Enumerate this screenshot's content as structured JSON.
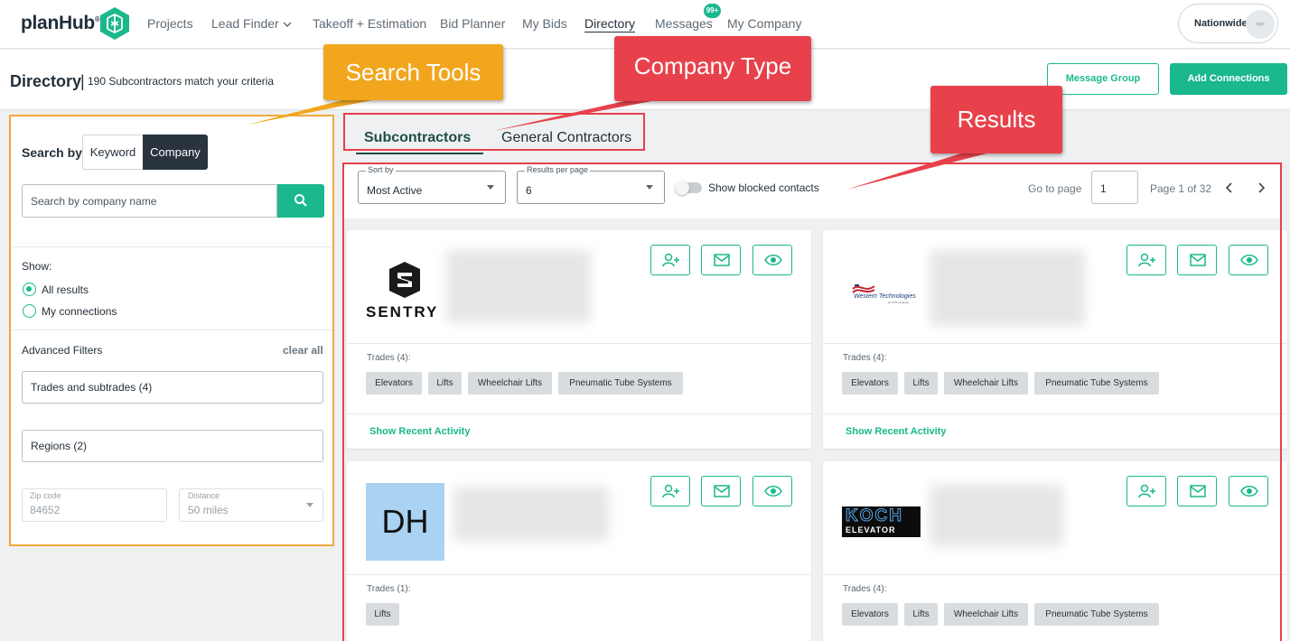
{
  "app": {
    "logo": "planHub",
    "logo_mark": "®"
  },
  "nav": {
    "items": [
      "Projects",
      "Lead Finder",
      "Takeoff + Estimation",
      "Bid Planner",
      "My Bids",
      "Directory",
      "Messages",
      "My Company"
    ],
    "messages_badge": "99+",
    "account": {
      "name": "Nationwide",
      "logo": "logo"
    }
  },
  "header": {
    "title": "Directory",
    "separator": "|",
    "subtitle": "190 Subcontractors match your criteria",
    "message_group": "Message Group",
    "add_connections": "Add Connections"
  },
  "sidebar": {
    "search_by": "Search by:",
    "keyword": "Keyword",
    "company": "Company",
    "search_placeholder": "Search by company name",
    "show": "Show:",
    "all_results": "All results",
    "my_connections": "My connections",
    "advanced_filters": "Advanced Filters",
    "clear_all": "clear all",
    "trades_filter": "Trades and subtrades (4)",
    "regions_filter": "Regions (2)",
    "zip_label": "Zip code",
    "zip_value": "84652",
    "distance_label": "Distance",
    "distance_value": "50 miles"
  },
  "tabs": {
    "subcontractors": "Subcontractors",
    "general_contractors": "General Contractors"
  },
  "toolbar": {
    "sort_label": "Sort by",
    "sort_value": "Most Active",
    "per_page_label": "Results per page",
    "per_page_value": "6",
    "blocked": "Show blocked contacts",
    "goto": "Go to page",
    "page_input": "1",
    "page_of": "Page 1 of 32"
  },
  "cards": [
    {
      "logo": "SENTRY",
      "trades_label": "Trades (4):",
      "trades": [
        "Elevators",
        "Lifts",
        "Wheelchair Lifts",
        "Pneumatic Tube Systems"
      ],
      "activity": "Show Recent Activity"
    },
    {
      "logo": "Western Technologies",
      "logo_sub": "an NV5 company",
      "trades_label": "Trades (4):",
      "trades": [
        "Elevators",
        "Lifts",
        "Wheelchair Lifts",
        "Pneumatic Tube Systems"
      ],
      "activity": "Show Recent Activity"
    },
    {
      "logo": "DH",
      "trades_label": "Trades (1):",
      "trades": [
        "Lifts"
      ]
    },
    {
      "logo": "KOCH",
      "logo_sub": "ELEVATOR",
      "trades_label": "Trades (4):",
      "trades": [
        "Elevators",
        "Lifts",
        "Wheelchair Lifts",
        "Pneumatic Tube Systems"
      ]
    }
  ],
  "callouts": {
    "search_tools": "Search Tools",
    "company_type": "Company Type",
    "results": "Results"
  },
  "colors": {
    "accent": "#1ab88c",
    "dark": "#29343e",
    "callout_orange": "#f2a61e",
    "callout_red": "#e8414b"
  }
}
